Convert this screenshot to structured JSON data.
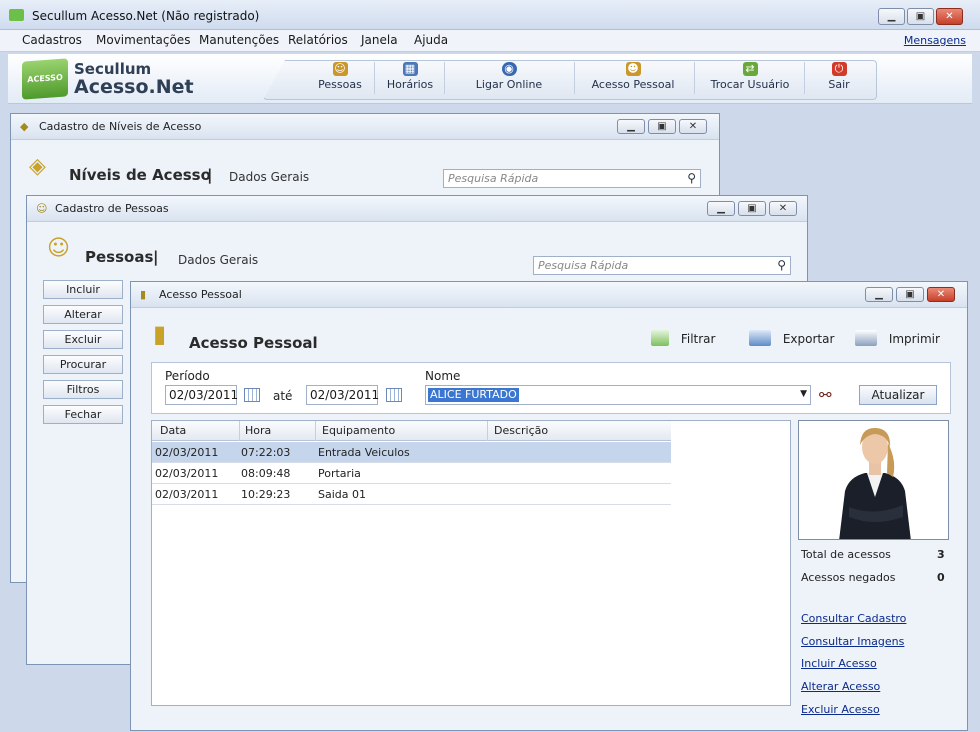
{
  "window": {
    "title": "Secullum Acesso.Net (Não registrado)",
    "min": "▁",
    "max": "▣",
    "close": "✕"
  },
  "menu": {
    "items": [
      "Cadastros",
      "Movimentações",
      "Manutenções",
      "Relatórios",
      "Janela",
      "Ajuda"
    ],
    "messages": "Mensagens"
  },
  "logo": {
    "badge": "ACESSO",
    "line1": "Secullum",
    "line2": "Acesso.Net"
  },
  "toolbar": {
    "buttons": [
      {
        "label": "Pessoas",
        "icon": "people-icon",
        "color": "#c9972a"
      },
      {
        "label": "Horários",
        "icon": "calendar-icon",
        "color": "#4d78b8"
      },
      {
        "label": "Ligar Online",
        "icon": "globe-icon",
        "color": "#3a68b0"
      },
      {
        "label": "Acesso Pessoal",
        "icon": "person-icon",
        "color": "#c9972a"
      },
      {
        "label": "Trocar Usuário",
        "icon": "swap-icon",
        "color": "#6aa83a"
      },
      {
        "label": "Sair",
        "icon": "power-icon",
        "color": "#d23a2a"
      }
    ]
  },
  "niveis": {
    "window_title": "Cadastro de Níveis de Acesso",
    "title": "Níveis de Acesso",
    "sep": "|",
    "subtitle": "Dados Gerais",
    "search_placeholder": "Pesquisa Rápida"
  },
  "pessoas": {
    "window_title": "Cadastro de Pessoas",
    "title": "Pessoas",
    "sep": "|",
    "subtitle": "Dados Gerais",
    "search_placeholder": "Pesquisa Rápida",
    "buttons": [
      "Incluir",
      "Alterar",
      "Excluir",
      "Procurar",
      "Filtros",
      "Fechar"
    ]
  },
  "acesso": {
    "window_title": "Acesso Pessoal",
    "title": "Acesso Pessoal",
    "actions": {
      "filtrar": "Filtrar",
      "exportar": "Exportar",
      "imprimir": "Imprimir"
    },
    "periodo_label": "Período",
    "date_from": "02/03/2011",
    "ate_label": "até",
    "date_to": "02/03/2011",
    "nome_label": "Nome",
    "nome_value": "ALICE FURTADO",
    "atualizar": "Atualizar",
    "columns": [
      "Data",
      "Hora",
      "Equipamento",
      "Descrição"
    ],
    "rows": [
      {
        "data": "02/03/2011",
        "hora": "07:22:03",
        "equipamento": "Entrada Veiculos",
        "descricao": ""
      },
      {
        "data": "02/03/2011",
        "hora": "08:09:48",
        "equipamento": "Portaria",
        "descricao": ""
      },
      {
        "data": "02/03/2011",
        "hora": "10:29:23",
        "equipamento": "Saida 01",
        "descricao": ""
      }
    ],
    "total_label": "Total de acessos",
    "total_value": "3",
    "negados_label": "Acessos negados",
    "negados_value": "0",
    "links": [
      "Consultar Cadastro",
      "Consultar Imagens",
      "Incluir Acesso",
      "Alterar Acesso",
      "Excluir Acesso"
    ]
  }
}
